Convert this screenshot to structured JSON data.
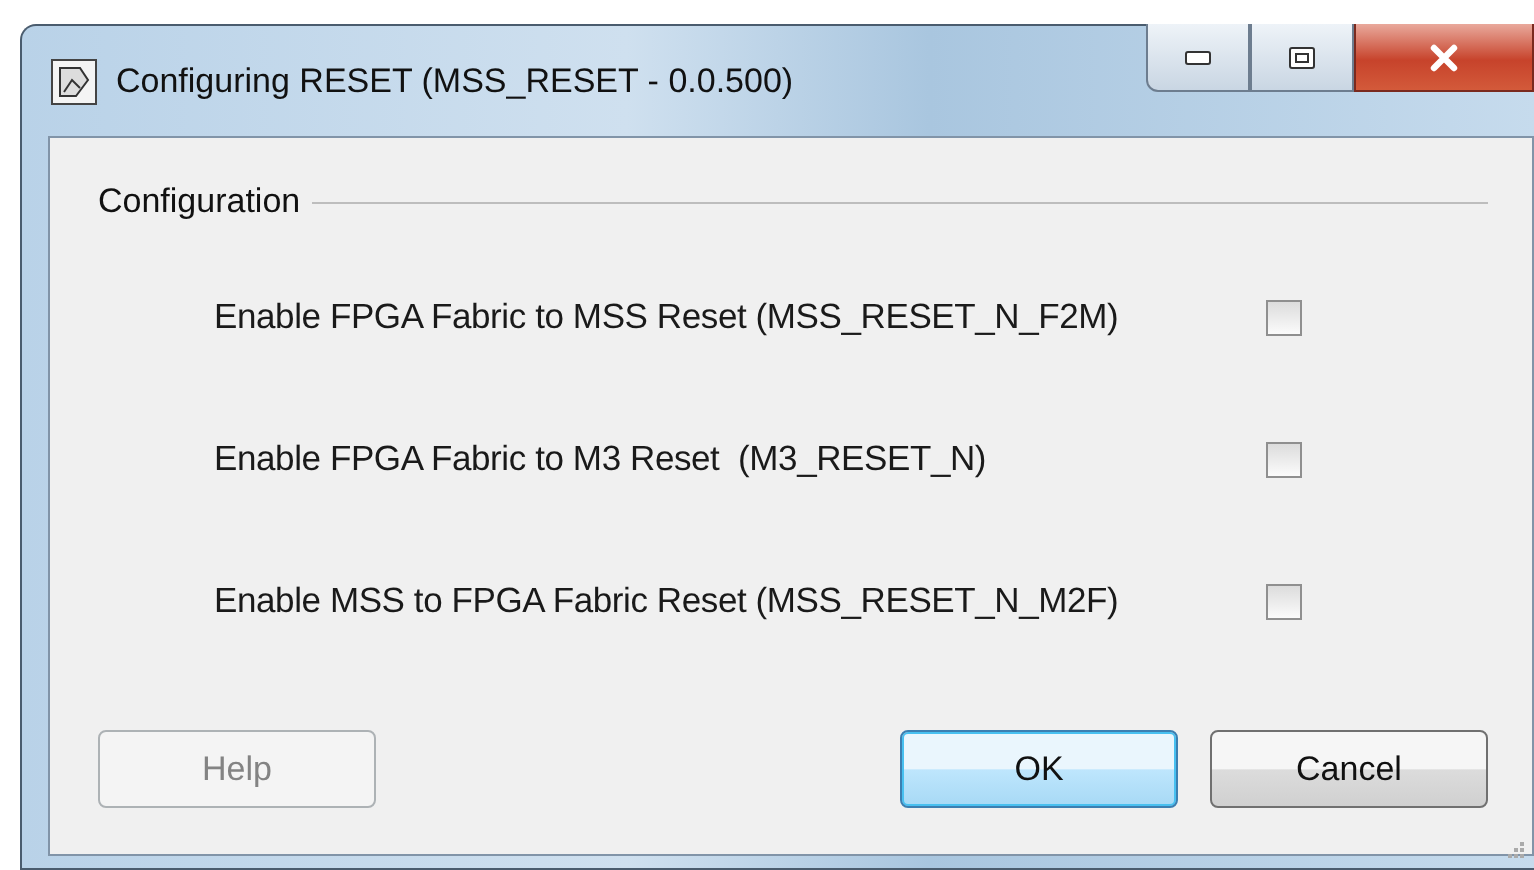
{
  "window": {
    "title": "Configuring RESET (MSS_RESET - 0.0.500)"
  },
  "group": {
    "label": "Configuration"
  },
  "options": [
    {
      "label": "Enable FPGA Fabric to MSS Reset (MSS_RESET_N_F2M)",
      "checked": false
    },
    {
      "label": "Enable FPGA Fabric to M3 Reset  (M3_RESET_N)",
      "checked": false
    },
    {
      "label": "Enable MSS to FPGA Fabric Reset (MSS_RESET_N_M2F)",
      "checked": false
    }
  ],
  "buttons": [
    {
      "label": "Help",
      "disabled": true,
      "default": false
    },
    {
      "label": "OK",
      "disabled": false,
      "default": true
    },
    {
      "label": "Cancel",
      "disabled": false,
      "default": false
    }
  ]
}
